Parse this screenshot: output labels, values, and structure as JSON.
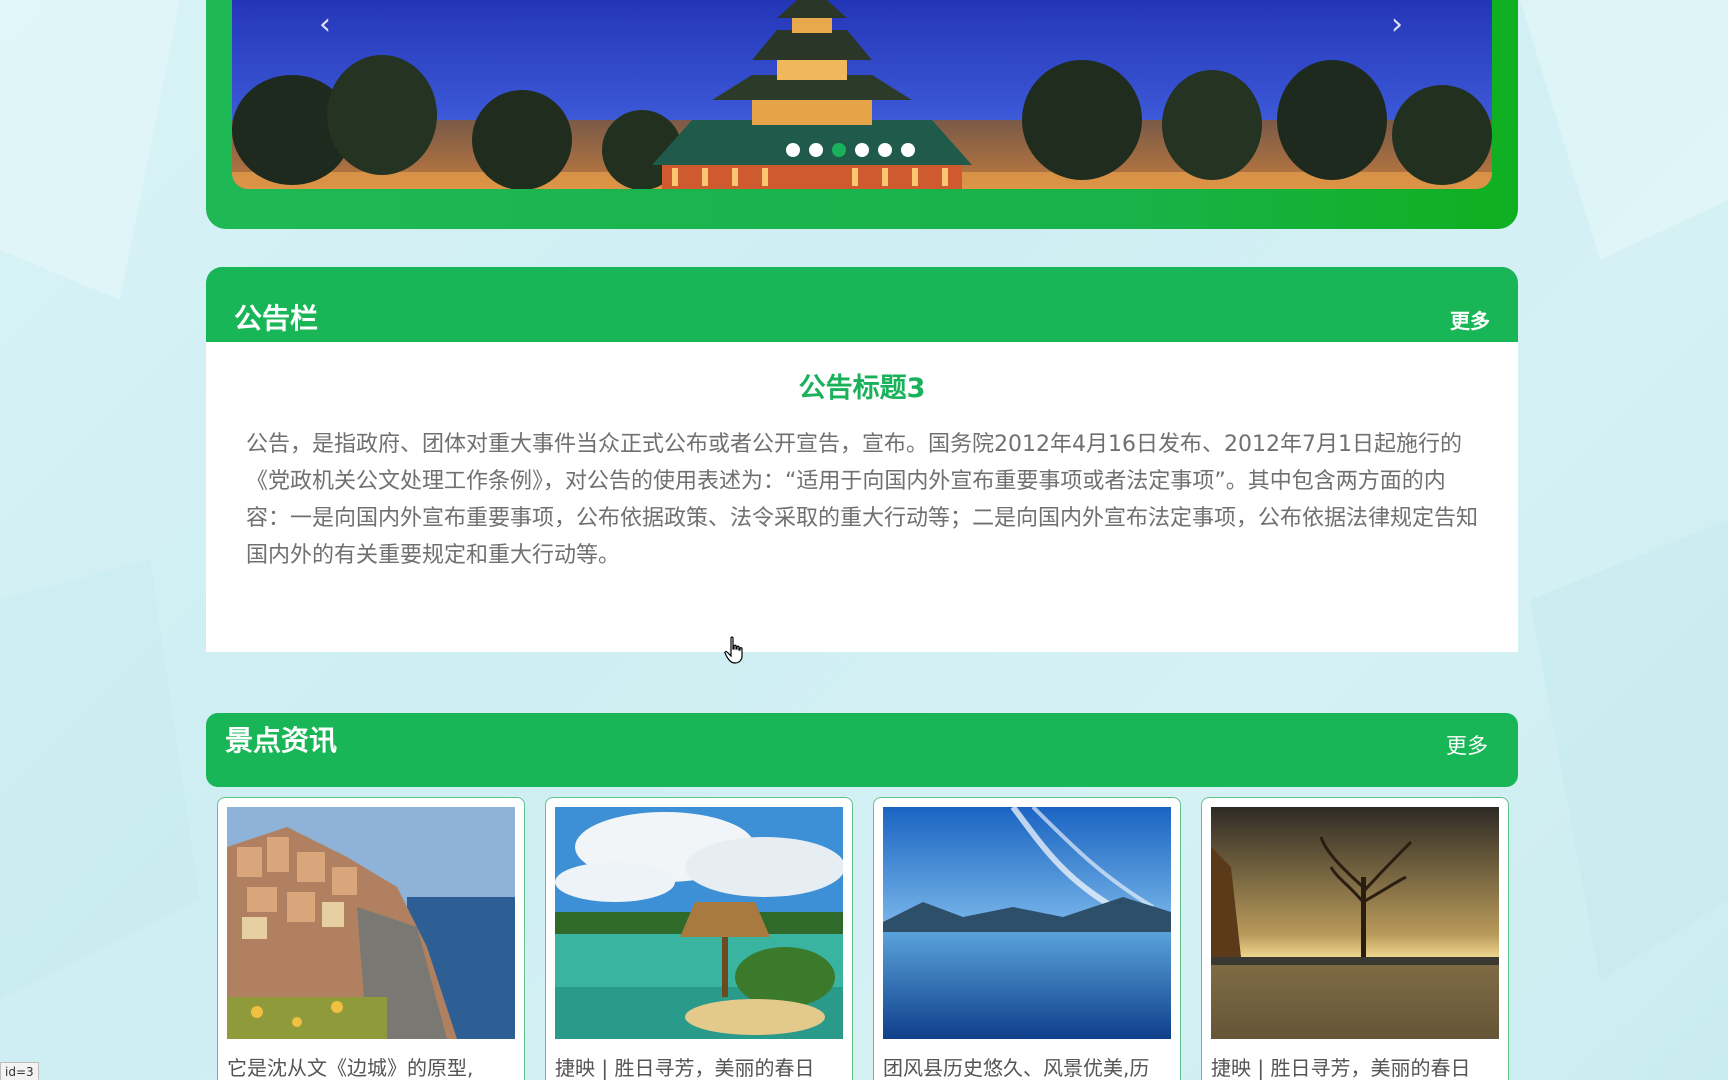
{
  "carousel": {
    "prev_icon": "chevron-left-icon",
    "next_icon": "chevron-right-icon",
    "prev_glyph": "‹",
    "next_glyph": "›",
    "dot_count": 6,
    "active_dot": 2
  },
  "notice": {
    "title": "公告栏",
    "more": "更多",
    "heading": "公告标题3",
    "text": "公告，是指政府、团体对重大事件当众正式公布或者公开宣告，宣布。国务院2012年4月16日发布、2012年7月1日起施行的《党政机关公文处理工作条例》，对公告的使用表述为：“适用于向国内外宣布重要事项或者法定事项”。其中包含两方面的内容：一是向国内外宣布重要事项，公布依据政策、法令采取的重大行动等；二是向国内外宣布法定事项，公布依据法律规定告知国内外的有关重要规定和重大行动等。"
  },
  "news": {
    "title": "景点资讯",
    "more": "更多",
    "items": [
      {
        "caption": "它是沈从文《边城》的原型,"
      },
      {
        "caption": "捷映 | 胜日寻芳，美丽的春日"
      },
      {
        "caption": "团风县历史悠久、风景优美,历"
      },
      {
        "caption": "捷映 | 胜日寻芳，美丽的春日"
      }
    ]
  },
  "status": {
    "text": "id=3"
  },
  "colors": {
    "primary": "#18b656",
    "accent_text": "#19b25a",
    "background": "#d3f0f4"
  }
}
